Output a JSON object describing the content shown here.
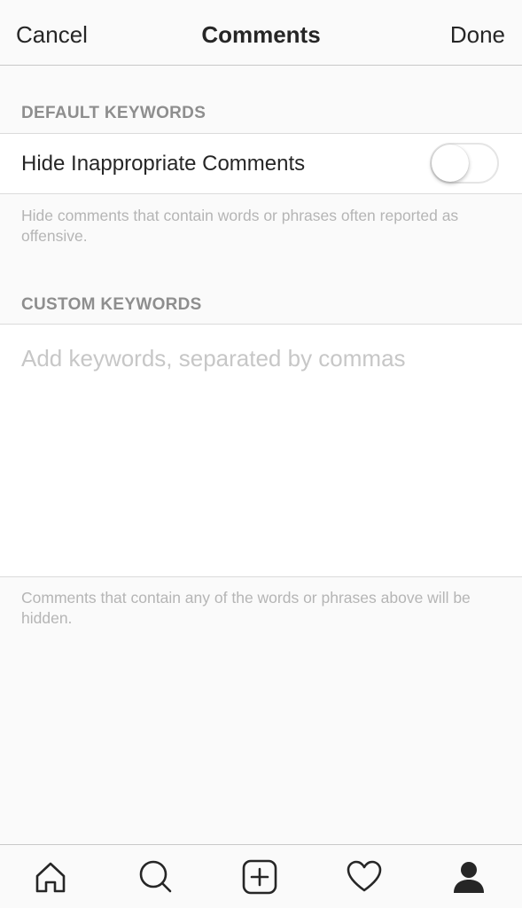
{
  "nav": {
    "cancel_label": "Cancel",
    "title": "Comments",
    "done_label": "Done"
  },
  "default_keywords": {
    "header": "DEFAULT KEYWORDS",
    "toggle_label": "Hide Inappropriate Comments",
    "toggle_on": false,
    "footnote": "Hide comments that contain words or phrases often reported as offensive."
  },
  "custom_keywords": {
    "header": "CUSTOM KEYWORDS",
    "input_placeholder": "Add keywords, separated by commas",
    "input_value": "",
    "footnote": "Comments that contain any of the words or phrases above will be hidden."
  },
  "tabbar": {
    "items": [
      {
        "icon": "home-icon"
      },
      {
        "icon": "search-icon"
      },
      {
        "icon": "add-post-icon"
      },
      {
        "icon": "heart-icon"
      },
      {
        "icon": "profile-icon",
        "active": true
      }
    ]
  },
  "colors": {
    "background": "#fafafa",
    "text": "#262626",
    "secondary_text": "#8e8e8e",
    "placeholder": "#c7c7c7",
    "divider": "#dbdbdb"
  }
}
